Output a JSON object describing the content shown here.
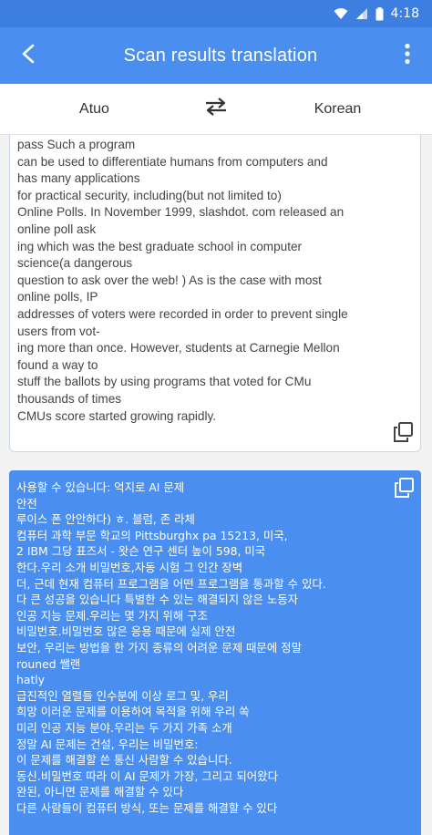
{
  "status_bar": {
    "time": "4:18",
    "icons": [
      "wifi-icon",
      "signal-icon",
      "battery-icon"
    ]
  },
  "app_bar": {
    "title": "Scan results translation",
    "back_icon": "back-arrow-icon",
    "menu_icon": "more-vert-icon"
  },
  "languages": {
    "source": "Atuo",
    "target": "Korean",
    "swap_icon": "swap-arrows-icon"
  },
  "source": {
    "lines": [
      "pass Such a program",
      "can be used to differentiate humans from computers and",
      "has many applications",
      "for practical security, including(but not limited to)",
      "Online Polls. In November 1999, slashdot. com released an",
      "online poll ask",
      "ing which was the best graduate school in computer",
      "science(a dangerous",
      "question to ask over the web! ) As is the case with most",
      "online polls, IP",
      "addresses of voters were recorded in order to prevent single",
      "users from vot-",
      "ing more than once. However, students at Carnegie Mellon",
      "found a way to",
      "stuff the ballots by using programs that voted for CMu",
      "thousands of times",
      "CMUs score started growing rapidly."
    ]
  },
  "target": {
    "lines": [
      "사용할 수 있습니다: 억지로 AI 문제",
      "안전",
      "루이스 폰 안안하다) ㅎ. 블럼, 존 라체",
      "컴퓨터 과학 부문 학교의 Pittsburghx pa 15213, 미국,",
      "2 IBM 그당 표즈서 - 왓슨 연구 센터 높이 598, 미국",
      "한다.우리 소개 비밀번호,자동 시험 그 인간 장벽",
      "더, 근데 현재 컴퓨터 프로그램을 어떤 프로그램을 통과할 수 있다.",
      "다 큰 성공을 있습니다 특별한 수 있는 해결되지 않은 노동자",
      "인공 지능 문제.우리는 몇 가지 위해 구조",
      "비밀번호.비밀번호 많은 응용 때문에 실제 안전",
      "보안, 우리는 방법을 한 가지 종류의 어려운 문제 때문에 정말",
      "rouned 쌜랜",
      "hatly",
      "급진적인 열렬들 인수분에 이상 로그 및, 우리",
      "희망 이러운 문제를 이용하여 목적을 위해 우리 쏙",
      "미리 인공 지능 분야.우리는 두 가지 가족 소개",
      "정말 AI 문제는 건설, 우리는 비밀번호:",
      "이 문제를 해결할 쓴 통신 사람할 수 있습니다.",
      "동신.비밀번호 따라 이 AI 문제가 가장, 그리고 되어왔다",
      "완된, 아니면 문제를 해결할 수 있다",
      "다른 사람들이 컴퓨터 방식, 또는 문제를 해결할 수 있다"
    ]
  },
  "colors": {
    "status_bar": "#3d7fe0",
    "app_bar": "#4a8ff0",
    "target_card": "#4a8ff0",
    "background": "#f2f2f2"
  }
}
